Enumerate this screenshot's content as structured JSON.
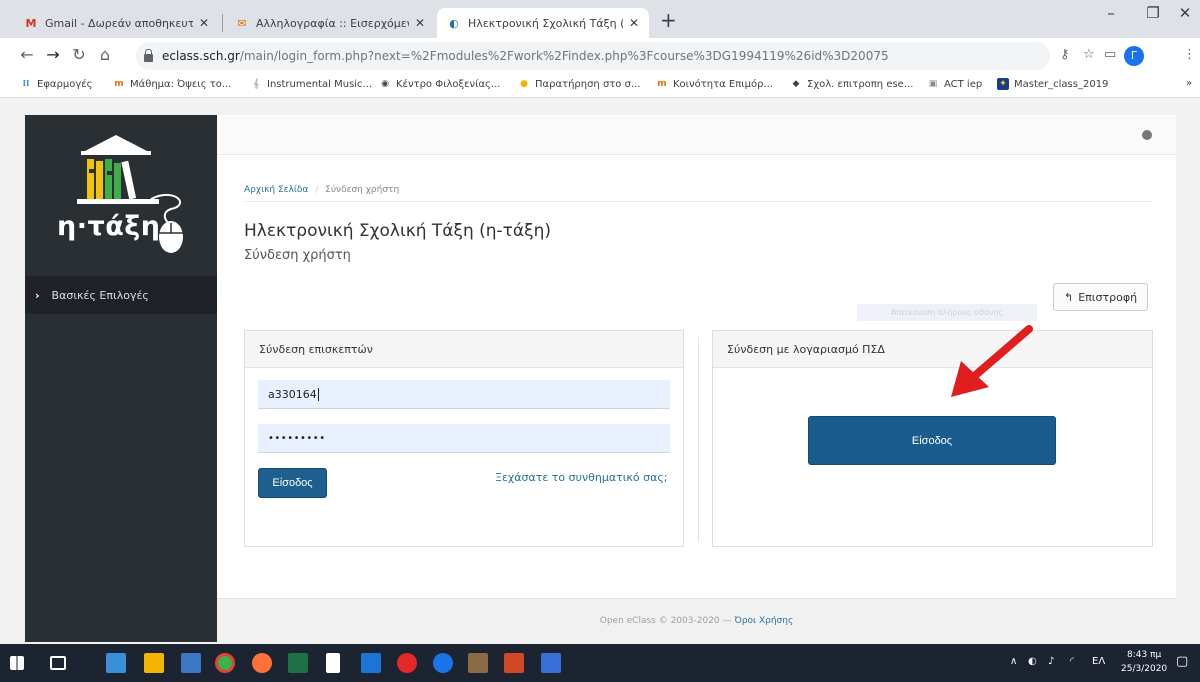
{
  "browser": {
    "tabs": [
      {
        "title": "Gmail - Δωρεάν αποθηκευτικός"
      },
      {
        "title": "Αλληλογραφία :: Εισερχόμενα"
      },
      {
        "title": "Ηλεκτρονική Σχολική Τάξη (η-Τά"
      }
    ],
    "url_host": "eclass.sch.gr",
    "url_path": "/main/login_form.php?next=%2Fmodules%2Fwork%2Findex.php%3Fcourse%3DG1994119%26id%3D20075",
    "avatar_letter": "Γ",
    "new_tab_symbol": "+",
    "more_symbol": "»"
  },
  "bookmarks": [
    {
      "label": "Εφαρμογές",
      "icon": "apps-grid-icon"
    },
    {
      "label": "Μάθημα: Όψεις το..."
    },
    {
      "label": "Instrumental Music..."
    },
    {
      "label": "Κέντρο Φιλοξενίας..."
    },
    {
      "label": "Παρατήρηση στο σ..."
    },
    {
      "label": "Κοινότητα Επιμόρ..."
    },
    {
      "label": "Σχολ. επιτροπη ese..."
    },
    {
      "label": "ACT iep"
    },
    {
      "label": "Master_class_2019"
    }
  ],
  "sidebar": {
    "logo_text": "η·τάξη",
    "menu_label": "Βασικές Επιλογές"
  },
  "breadcrumb": {
    "home": "Αρχική Σελίδα",
    "separator": "/",
    "current": "Σύνδεση χρήστη"
  },
  "page": {
    "title": "Ηλεκτρονική Σχολική Τάξη (η-τάξη)",
    "subtitle": "Σύνδεση χρήστη",
    "back_button": "Επιστροφή",
    "ghost_text": "Απεικόνιση πλήρους οθόνης"
  },
  "guest_login": {
    "heading": "Σύνδεση επισκεπτών",
    "username_value": "a330164",
    "password_mask": "•••••••••",
    "submit_label": "Είσοδος",
    "forgot_link": "Ξεχάσατε το συνθηματικό σας;"
  },
  "psd_login": {
    "heading": "Σύνδεση με λογαριασμό ΠΣΔ",
    "submit_label": "Είσοδος"
  },
  "footer": {
    "copyright": "Open eClass © 2003-2020 —",
    "terms": "Όροι Χρήσης"
  },
  "taskbar": {
    "time": "8:43 πμ",
    "date": "25/3/2020",
    "language": "ΕΛ"
  },
  "colors": {
    "sidebar": "#2a2f34",
    "primary_button": "#1b5c8e",
    "link": "#2a6fa0",
    "annotation_arrow": "#e01e1e"
  }
}
